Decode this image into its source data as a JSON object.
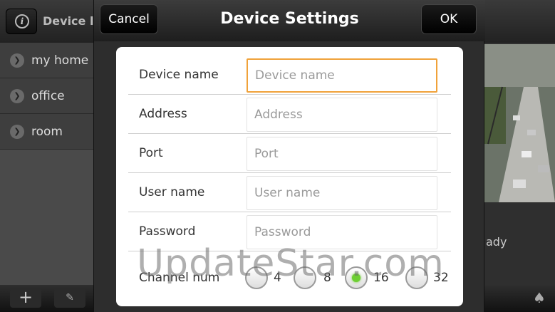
{
  "background": {
    "title": "Device list",
    "info_icon_glyph": "i",
    "devices": [
      {
        "label": "my home"
      },
      {
        "label": "office"
      },
      {
        "label": "room"
      }
    ],
    "status_fragment": "ady",
    "add_glyph": "+",
    "edit_glyph": "✎",
    "drop_glyph": "♠"
  },
  "dialog": {
    "title": "Device Settings",
    "cancel_label": "Cancel",
    "ok_label": "OK",
    "fields": [
      {
        "label": "Device name",
        "placeholder": "Device name",
        "value": ""
      },
      {
        "label": "Address",
        "placeholder": "Address",
        "value": ""
      },
      {
        "label": "Port",
        "placeholder": "Port",
        "value": ""
      },
      {
        "label": "User name",
        "placeholder": "User name",
        "value": ""
      },
      {
        "label": "Password",
        "placeholder": "Password",
        "value": ""
      }
    ],
    "channel": {
      "label": "Channel num",
      "options": [
        "4",
        "8",
        "16",
        "32"
      ],
      "selected": "16"
    }
  },
  "watermark": "UpdateStar.com",
  "colors": {
    "focus_border": "#f0a23a",
    "radio_selected": "#6ecf33"
  }
}
